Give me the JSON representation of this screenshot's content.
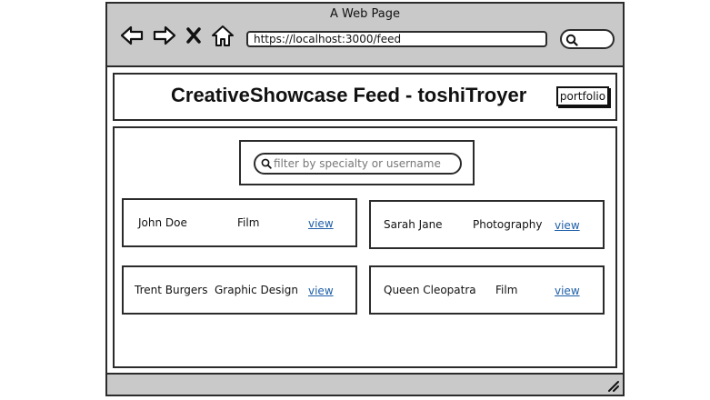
{
  "window": {
    "title": "A Web Page"
  },
  "browser": {
    "url": "https://localhost:3000/feed",
    "icons": [
      "back-arrow-icon",
      "forward-arrow-icon",
      "close-x-icon",
      "home-icon",
      "search-icon"
    ]
  },
  "header": {
    "title": "CreativeShowcase Feed - toshiTroyer",
    "portfolio_label": "portfolio"
  },
  "filter": {
    "placeholder": "filter by specialty or username"
  },
  "cards": [
    {
      "name": "John Doe",
      "specialty": "Film",
      "link": "view"
    },
    {
      "name": "Sarah Jane",
      "specialty": "Photography",
      "link": "view"
    },
    {
      "name": "Trent Burgers",
      "specialty": "Graphic Design",
      "link": "view"
    },
    {
      "name": "Queen Cleopatra",
      "specialty": "Film",
      "link": "view"
    }
  ],
  "colors": {
    "chrome": "#c9c9c9",
    "border": "#2b2b2b",
    "link": "#1f5fa8"
  }
}
